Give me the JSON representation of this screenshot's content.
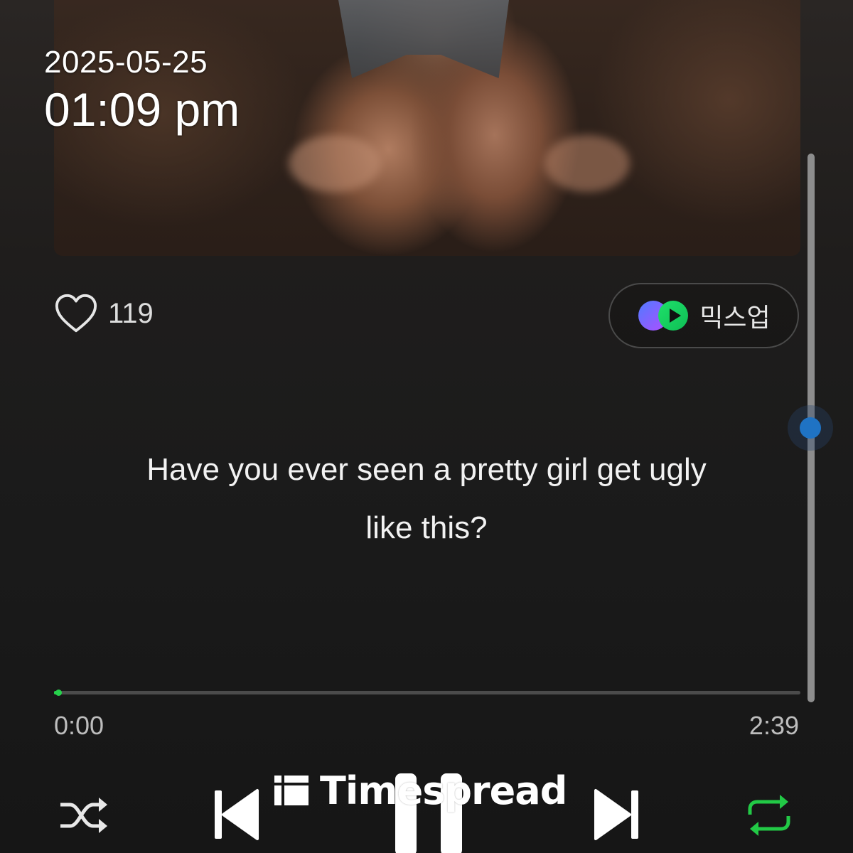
{
  "overlay": {
    "date": "2025-05-25",
    "time": "01:09 pm"
  },
  "album": {
    "art_icon": "album-cover-photo"
  },
  "like": {
    "icon": "heart-outline-icon",
    "count": "119"
  },
  "mixup": {
    "icon": "mixup-logo-icon",
    "label": "믹스업"
  },
  "lyrics": {
    "line1": "Have you ever seen a pretty girl get ugly",
    "line2": "like this?"
  },
  "playback": {
    "elapsed": "0:00",
    "total": "2:39",
    "progress_fraction": 0.004
  },
  "controls": {
    "shuffle_icon": "shuffle-icon",
    "prev_icon": "skip-previous-icon",
    "pause_icon": "pause-icon",
    "next_icon": "skip-next-icon",
    "repeat_icon": "repeat-icon"
  },
  "watermark": {
    "text": "Timespread"
  },
  "colors": {
    "accent": "#26d14b",
    "scroll_thumb": "#1f73c4",
    "background": "#1b1b1b"
  }
}
